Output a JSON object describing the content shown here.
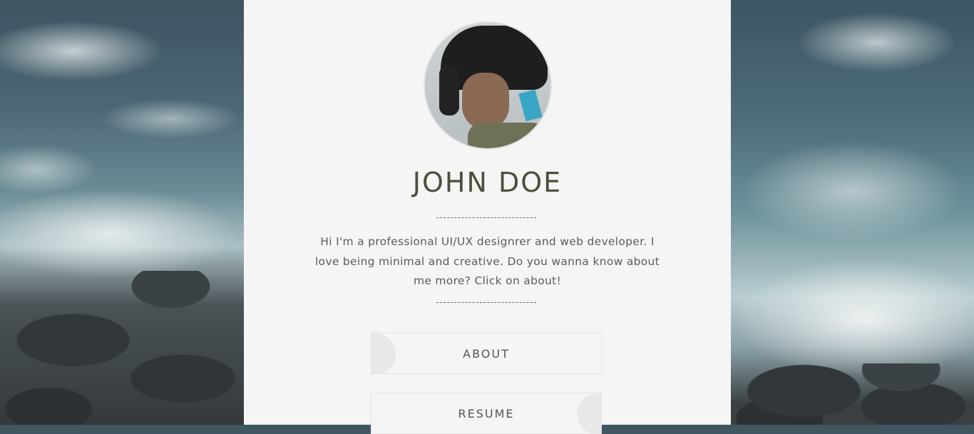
{
  "profile": {
    "name": "JOHN DOE",
    "bio": "Hi I'm a professional UI/UX designrer and web developer. I love being minimal and creative. Do you wanna know about me more? Click on about!"
  },
  "nav": {
    "about_label": "ABOUT",
    "resume_label": "RESUME"
  },
  "colors": {
    "panel": "#f5f5f5",
    "name_text": "#4b4f3c",
    "body_text": "#5c5c5c"
  }
}
